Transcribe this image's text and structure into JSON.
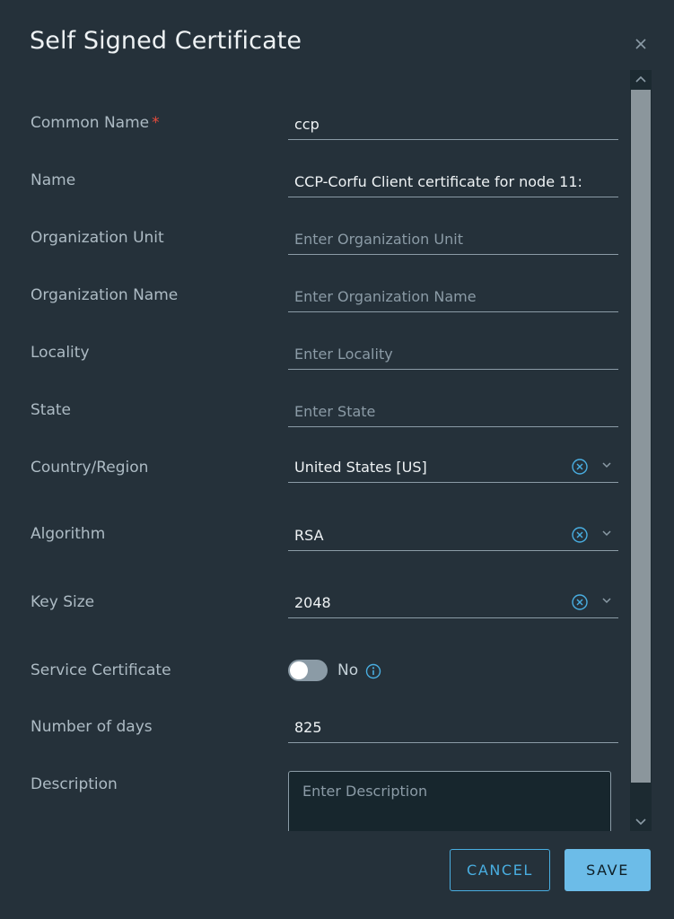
{
  "modal": {
    "title": "Self Signed Certificate"
  },
  "form": {
    "common_name": {
      "label": "Common Name",
      "required_mark": "*",
      "value": "ccp",
      "placeholder": ""
    },
    "name": {
      "label": "Name",
      "value": "CCP-Corfu Client certificate for node 11:",
      "placeholder": ""
    },
    "organization_unit": {
      "label": "Organization Unit",
      "value": "",
      "placeholder": "Enter Organization Unit"
    },
    "organization_name": {
      "label": "Organization Name",
      "value": "",
      "placeholder": "Enter Organization Name"
    },
    "locality": {
      "label": "Locality",
      "value": "",
      "placeholder": "Enter Locality"
    },
    "state": {
      "label": "State",
      "value": "",
      "placeholder": "Enter State"
    },
    "country_region": {
      "label": "Country/Region",
      "selected": "United States [US]"
    },
    "algorithm": {
      "label": "Algorithm",
      "selected": "RSA"
    },
    "key_size": {
      "label": "Key Size",
      "selected": "2048"
    },
    "service_certificate": {
      "label": "Service Certificate",
      "toggle_state": "No",
      "enabled": false
    },
    "number_of_days": {
      "label": "Number of days",
      "value": "825",
      "placeholder": ""
    },
    "description": {
      "label": "Description",
      "value": "",
      "placeholder": "Enter Description"
    }
  },
  "footer": {
    "cancel_label": "CANCEL",
    "save_label": "SAVE"
  },
  "colors": {
    "background": "#25313a",
    "accent": "#49aee1",
    "primary_button": "#6cbce8",
    "required": "#e74c3c"
  },
  "icons": {
    "close": "close-icon",
    "clear": "clear-circle-icon",
    "chevron": "chevron-down-icon",
    "info": "info-icon"
  }
}
